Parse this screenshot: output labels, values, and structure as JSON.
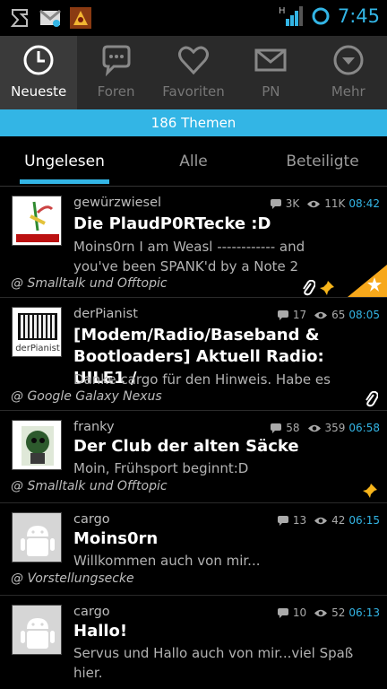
{
  "status": {
    "time": "7:45",
    "network": "H"
  },
  "tabs": [
    {
      "label": "Neueste",
      "icon": "clock-icon",
      "active": true
    },
    {
      "label": "Foren",
      "icon": "chat-bubble-icon",
      "active": false
    },
    {
      "label": "Favoriten",
      "icon": "heart-icon",
      "active": false
    },
    {
      "label": "PN",
      "icon": "envelope-icon",
      "active": false
    },
    {
      "label": "Mehr",
      "icon": "chevron-down-circle-icon",
      "active": false
    }
  ],
  "topic_count": "186 Themen",
  "subtabs": [
    {
      "label": "Ungelesen",
      "active": true
    },
    {
      "label": "Alle",
      "active": false
    },
    {
      "label": "Beteiligte",
      "active": false
    }
  ],
  "threads": [
    {
      "author": "gewürzwiesel",
      "replies": "3K",
      "views": "11K",
      "time": "08:42",
      "title": "Die PlaudP0RTecke :D",
      "snippet_lines": [
        "Moins0rn I am Weasl ------------ and",
        "you've been SPANK'd by a Note 2"
      ],
      "forum": "@ Smalltalk und Offtopic",
      "attachment": true,
      "pinned": true,
      "starred": true
    },
    {
      "author": "derPianist",
      "replies": "17",
      "views": "65",
      "time": "08:05",
      "title_lines": [
        "[Modem/Radio/Baseband &",
        "Bootloaders] Aktuell Radio: UILE1 /"
      ],
      "snippet_lines": [
        "Danke cargo für den Hinweis. Habe es"
      ],
      "forum": "@ Google Galaxy Nexus",
      "avatar_label": "derPianist",
      "attachment": true,
      "pinned": false,
      "starred": false
    },
    {
      "author": "franky",
      "replies": "58",
      "views": "359",
      "time": "06:58",
      "title": "Der Club der alten Säcke",
      "snippet_lines": [
        "Moin, Frühsport beginnt:D"
      ],
      "forum": "@ Smalltalk und Offtopic",
      "attachment": false,
      "pinned": true,
      "starred": false
    },
    {
      "author": "cargo",
      "replies": "13",
      "views": "42",
      "time": "06:15",
      "title": "Moins0rn",
      "snippet_lines": [
        "Willkommen auch von mir..."
      ],
      "forum": "@ Vorstellungsecke",
      "attachment": false,
      "pinned": false,
      "starred": false
    },
    {
      "author": "cargo",
      "replies": "10",
      "views": "52",
      "time": "06:13",
      "title": "Hallo!",
      "snippet_lines": [
        "Servus und Hallo auch von mir...viel Spaß",
        "hier."
      ],
      "attachment": false,
      "pinned": false,
      "starred": false
    }
  ],
  "colors": {
    "accent": "#33b5e5",
    "star_corner": "#f7a81b",
    "pin": "#f7b51b"
  }
}
